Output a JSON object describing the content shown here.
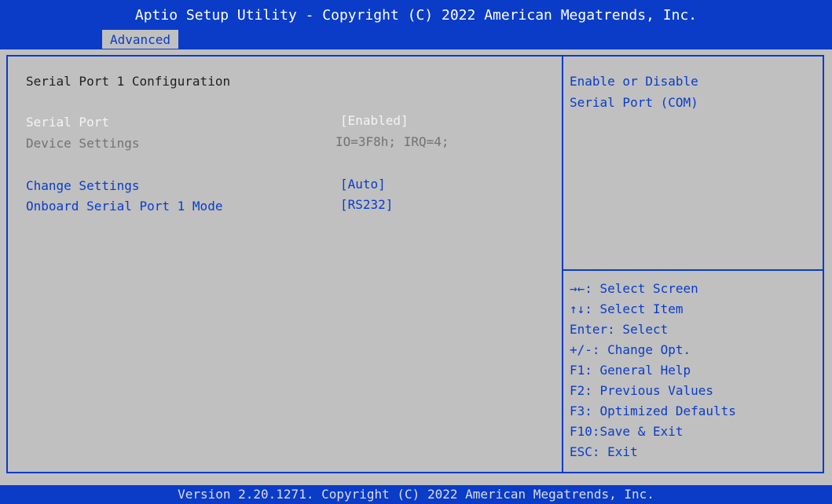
{
  "header": {
    "title": "Aptio Setup Utility - Copyright (C) 2022 American Megatrends, Inc.",
    "active_tab": "Advanced"
  },
  "main": {
    "heading": "Serial Port 1 Configuration",
    "settings": [
      {
        "label": "Serial Port",
        "value": "[Enabled]"
      },
      {
        "label": "Device Settings",
        "value": "IO=3F8h; IRQ=4;"
      },
      {
        "label": "Change Settings",
        "value": "[Auto]"
      },
      {
        "label": "Onboard Serial Port 1 Mode",
        "value": "[RS232]"
      }
    ]
  },
  "help": {
    "lines": [
      "Enable or Disable",
      "Serial Port (COM)"
    ]
  },
  "keys": [
    "→←: Select Screen",
    "↑↓: Select Item",
    "Enter: Select",
    "+/-: Change Opt.",
    "F1: General Help",
    "F2: Previous Values",
    "F3: Optimized Defaults",
    "F10:Save & Exit",
    "ESC: Exit"
  ],
  "footer": {
    "text": "Version 2.20.1271. Copyright (C) 2022 American Megatrends, Inc."
  },
  "colors": {
    "accent": "#0a3cc8",
    "background": "#c0c0c0",
    "selected_text": "#f4f4f4",
    "disabled_text": "#727272"
  }
}
